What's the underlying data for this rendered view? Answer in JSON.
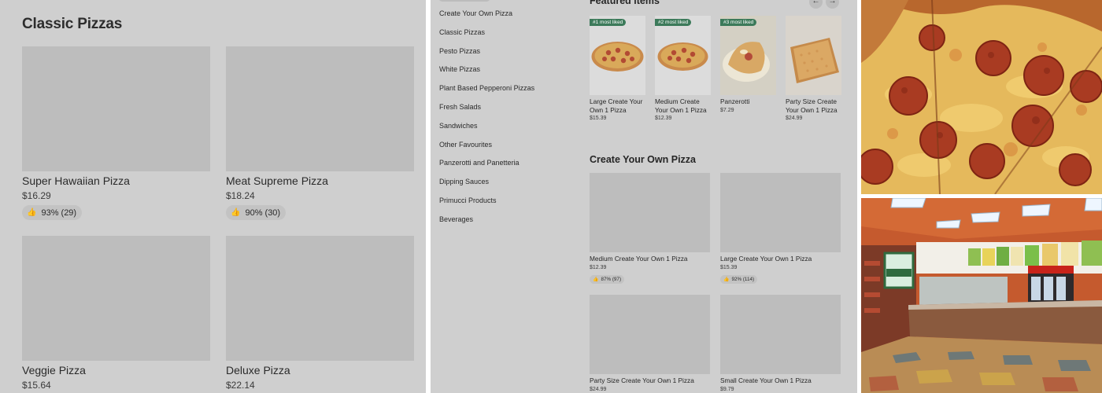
{
  "left": {
    "title": "Classic Pizzas",
    "items": [
      {
        "name": "Super Hawaiian Pizza",
        "price": "$16.29",
        "rating": "93% (29)"
      },
      {
        "name": "Meat Supreme Pizza",
        "price": "$18.24",
        "rating": "90% (30)"
      },
      {
        "name": "Veggie Pizza",
        "price": "$15.64"
      },
      {
        "name": "Deluxe Pizza",
        "price": "$22.14"
      }
    ]
  },
  "mid": {
    "sidebar": [
      "Create Your Own Pizza",
      "Classic Pizzas",
      "Pesto Pizzas",
      "White Pizzas",
      "Plant Based Pepperoni Pizzas",
      "Fresh Salads",
      "Sandwiches",
      "Other Favourites",
      "Panzerotti and Panetteria",
      "Dipping Sauces",
      "Primucci Products",
      "Beverages"
    ],
    "featured": {
      "title": "Featured items",
      "prev_icon": "←",
      "next_icon": "→",
      "items": [
        {
          "badge": "#1 most liked",
          "name": "Large Create Your Own 1 Pizza",
          "price": "$15.39"
        },
        {
          "badge": "#2 most liked",
          "name": "Medium Create Your Own 1 Pizza",
          "price": "$12.39"
        },
        {
          "badge": "#3 most liked",
          "name": "Panzerotti",
          "price": "$7.29"
        },
        {
          "name": "Party Size Create Your Own 1 Pizza",
          "price": "$24.99"
        }
      ]
    },
    "create": {
      "title": "Create Your Own Pizza",
      "items": [
        {
          "name": "Medium Create Your Own 1 Pizza",
          "price": "$12.39",
          "rating": "87% (97)"
        },
        {
          "name": "Large Create Your Own 1 Pizza",
          "price": "$15.39",
          "rating": "92% (114)"
        },
        {
          "name": "Party Size Create Your Own 1 Pizza",
          "price": "$24.99"
        },
        {
          "name": "Small Create Your Own 1 Pizza",
          "price": "$9.79"
        }
      ]
    }
  },
  "icons": {
    "thumb": "👍"
  },
  "colors": {
    "badge": "#3c7a5a",
    "overlay_gray": "#cfcfcf",
    "placeholder": "#bdbdbd"
  }
}
